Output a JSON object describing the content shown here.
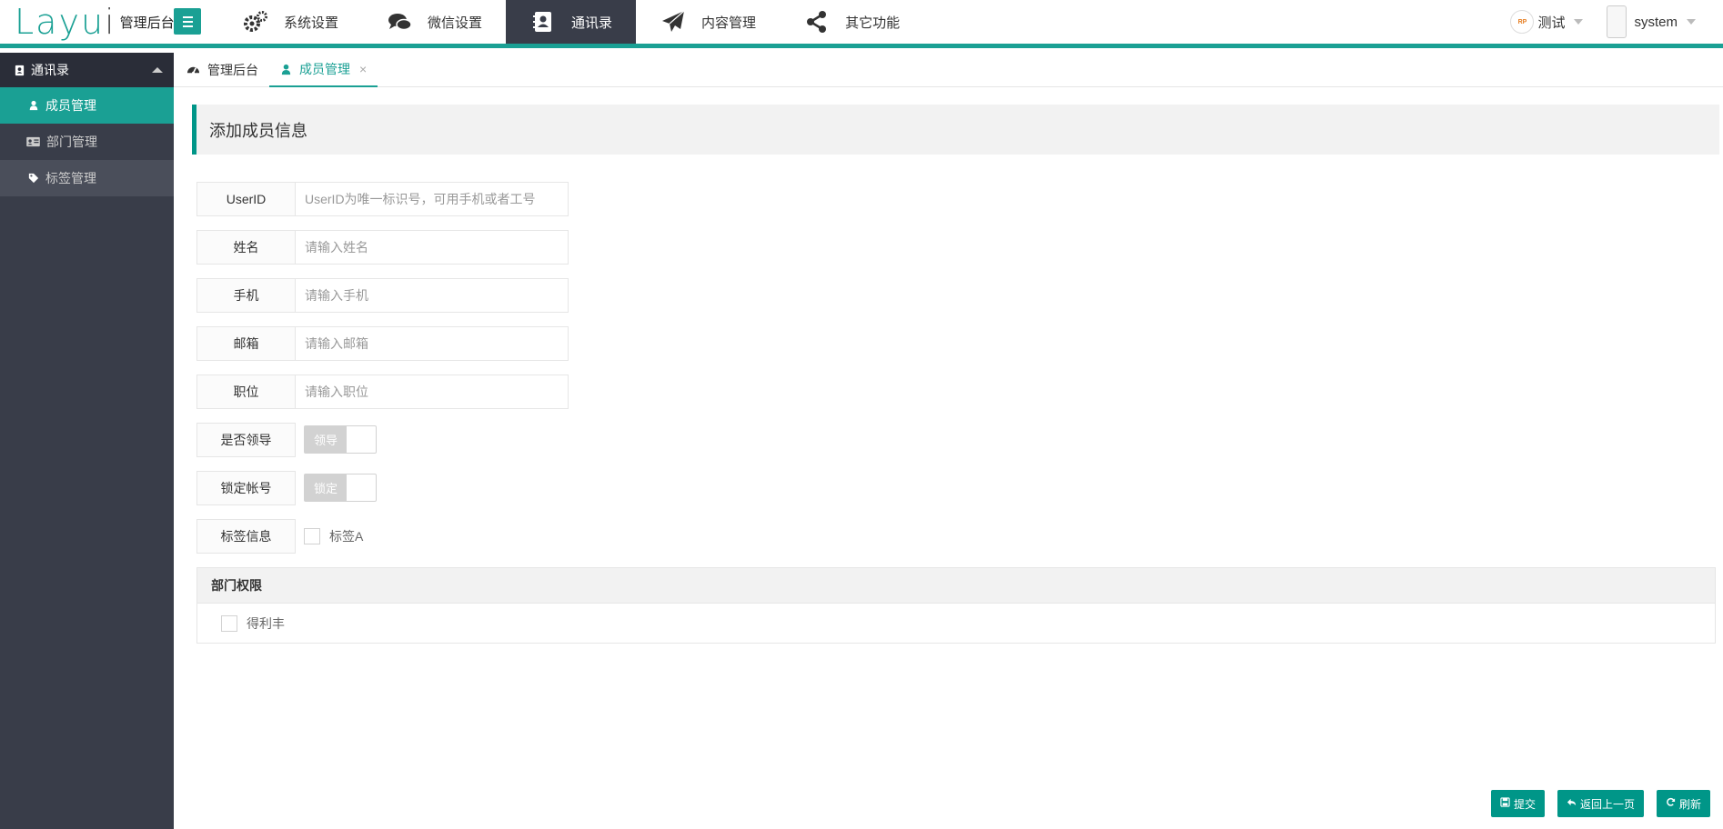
{
  "header": {
    "logo_main": "Layui",
    "logo_sub": "管理后台",
    "nav": [
      {
        "label": "系统设置",
        "icon": "gears-icon"
      },
      {
        "label": "微信设置",
        "icon": "chat-icon"
      },
      {
        "label": "通讯录",
        "icon": "address-book-icon"
      },
      {
        "label": "内容管理",
        "icon": "paper-plane-icon"
      },
      {
        "label": "其它功能",
        "icon": "share-icon"
      }
    ],
    "active_nav": 2,
    "right": {
      "org_label": "测试",
      "user_label": "system"
    }
  },
  "sidebar": {
    "group_label": "通讯录",
    "items": [
      {
        "label": "成员管理",
        "icon": "user-icon"
      },
      {
        "label": "部门管理",
        "icon": "id-card-icon"
      },
      {
        "label": "标签管理",
        "icon": "tag-icon"
      }
    ]
  },
  "tabs": [
    {
      "label": "管理后台",
      "icon": "dashboard-icon"
    },
    {
      "label": "成员管理",
      "icon": "user-icon",
      "close": "×"
    }
  ],
  "form": {
    "title": "添加成员信息",
    "fields": [
      {
        "label": "UserID",
        "placeholder": "UserID为唯一标识号，可用手机或者工号"
      },
      {
        "label": "姓名",
        "placeholder": "请输入姓名"
      },
      {
        "label": "手机",
        "placeholder": "请输入手机"
      },
      {
        "label": "邮箱",
        "placeholder": "请输入邮箱"
      },
      {
        "label": "职位",
        "placeholder": "请输入职位"
      }
    ],
    "leader": {
      "label": "是否领导",
      "switch_text": "领导"
    },
    "lock": {
      "label": "锁定帐号",
      "switch_text": "锁定"
    },
    "tags": {
      "label": "标签信息",
      "option": "标签A"
    },
    "dept": {
      "title": "部门权限",
      "option": "得利丰"
    }
  },
  "buttons": {
    "submit": "提交",
    "back": "返回上一页",
    "refresh": "刷新"
  },
  "colors": {
    "accent": "#1aa094",
    "nav_dark": "#393d49",
    "button": "#009688"
  }
}
